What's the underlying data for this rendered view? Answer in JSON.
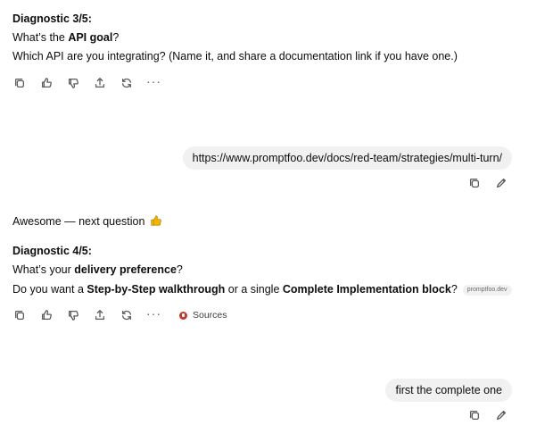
{
  "message1": {
    "heading": "Diagnostic 3/5:",
    "q_prefix": "What’s the ",
    "q_bold": "API goal",
    "q_suffix": "?",
    "detail": "Which API are you integrating? (Name it, and share a documentation link if you have one.)"
  },
  "toolbar_icons": [
    "copy-icon",
    "thumbs-up-icon",
    "thumbs-down-icon",
    "share-icon",
    "regenerate-icon",
    "more-icon"
  ],
  "user_message1": {
    "text": "https://www.promptfoo.dev/docs/red-team/strategies/multi-turn/"
  },
  "message2": {
    "intro": "Awesome — next question",
    "intro_emoji": "thumbs-up-emoji",
    "heading": "Diagnostic 4/5:",
    "q_prefix": "What’s your ",
    "q_bold": "delivery preference",
    "q_suffix": "?",
    "d_prefix": "Do you want a ",
    "d_bold1": "Step-by-Step walkthrough",
    "d_mid": " or a single ",
    "d_bold2": "Complete Implementation block",
    "d_suffix": "?",
    "citation": "promptfoo.dev",
    "sources_label": "Sources"
  },
  "user_message2": {
    "text": "first the  complete one"
  }
}
